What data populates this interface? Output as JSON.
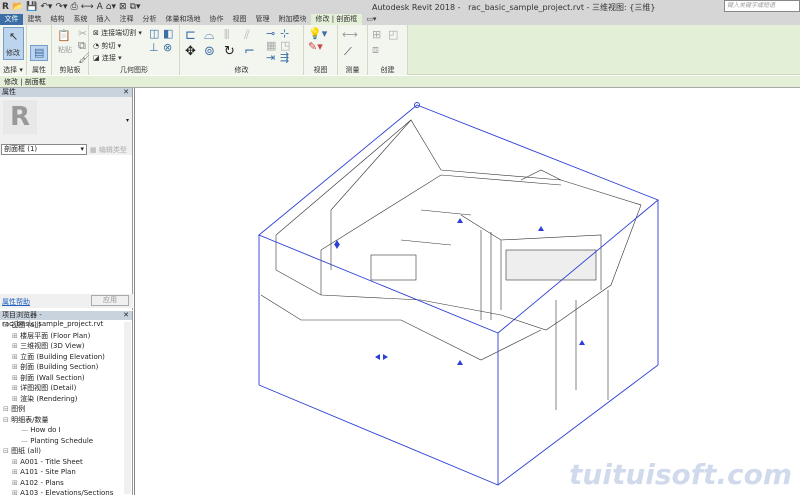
{
  "title": {
    "app": "Autodesk Revit 2018 -",
    "file": "rac_basic_sample_project.rvt - 三维视图: {三维}",
    "search_placeholder": "键入关键字或短语"
  },
  "menu": [
    "文件",
    "建筑",
    "结构",
    "系统",
    "插入",
    "注释",
    "分析",
    "体量和场地",
    "协作",
    "视图",
    "管理",
    "附加模块",
    "修改 | 剖面框"
  ],
  "ribbon": {
    "modify": "修改",
    "select": "选择 ▾",
    "properties": "属性",
    "clipboard": "剪贴板",
    "paste": "粘贴",
    "join_cut": "连接端切割",
    "cut": "剪切",
    "join": "连接",
    "geometry": "几何图形",
    "modify_panel": "修改",
    "view": "视图",
    "measure": "测量",
    "create": "创建"
  },
  "context": "修改 | 剖面框",
  "properties": {
    "title": "属性",
    "type_selector": "剖面框 (1)",
    "edit_type": "编辑类型",
    "help": "属性帮助",
    "apply": "应用"
  },
  "browser": {
    "title": "项目浏览器 - rac_basic_sample_project.rvt",
    "items": [
      {
        "label": "视图 (all)",
        "level": 0
      },
      {
        "label": "楼层平面 (Floor Plan)",
        "level": 1
      },
      {
        "label": "三维视图 (3D View)",
        "level": 1
      },
      {
        "label": "立面 (Building Elevation)",
        "level": 1
      },
      {
        "label": "剖面 (Building Section)",
        "level": 1
      },
      {
        "label": "剖面 (Wall Section)",
        "level": 1
      },
      {
        "label": "详图视图 (Detail)",
        "level": 1
      },
      {
        "label": "渲染 (Rendering)",
        "level": 1
      },
      {
        "label": "图例",
        "level": 0
      },
      {
        "label": "明细表/数量",
        "level": 0
      },
      {
        "label": "How do I",
        "level": 2
      },
      {
        "label": "Planting Schedule",
        "level": 2
      },
      {
        "label": "图纸 (all)",
        "level": 0
      },
      {
        "label": "A001 - Title Sheet",
        "level": 1
      },
      {
        "label": "A101 - Site Plan",
        "level": 1
      },
      {
        "label": "A102 - Plans",
        "level": 1
      },
      {
        "label": "A103 - Elevations/Sections",
        "level": 1
      }
    ]
  },
  "watermark": "tuituisoft.com",
  "colors": {
    "accent": "#3a6ea5",
    "ribbon": "#e4efd8",
    "section_box": "#2b3fd6"
  }
}
